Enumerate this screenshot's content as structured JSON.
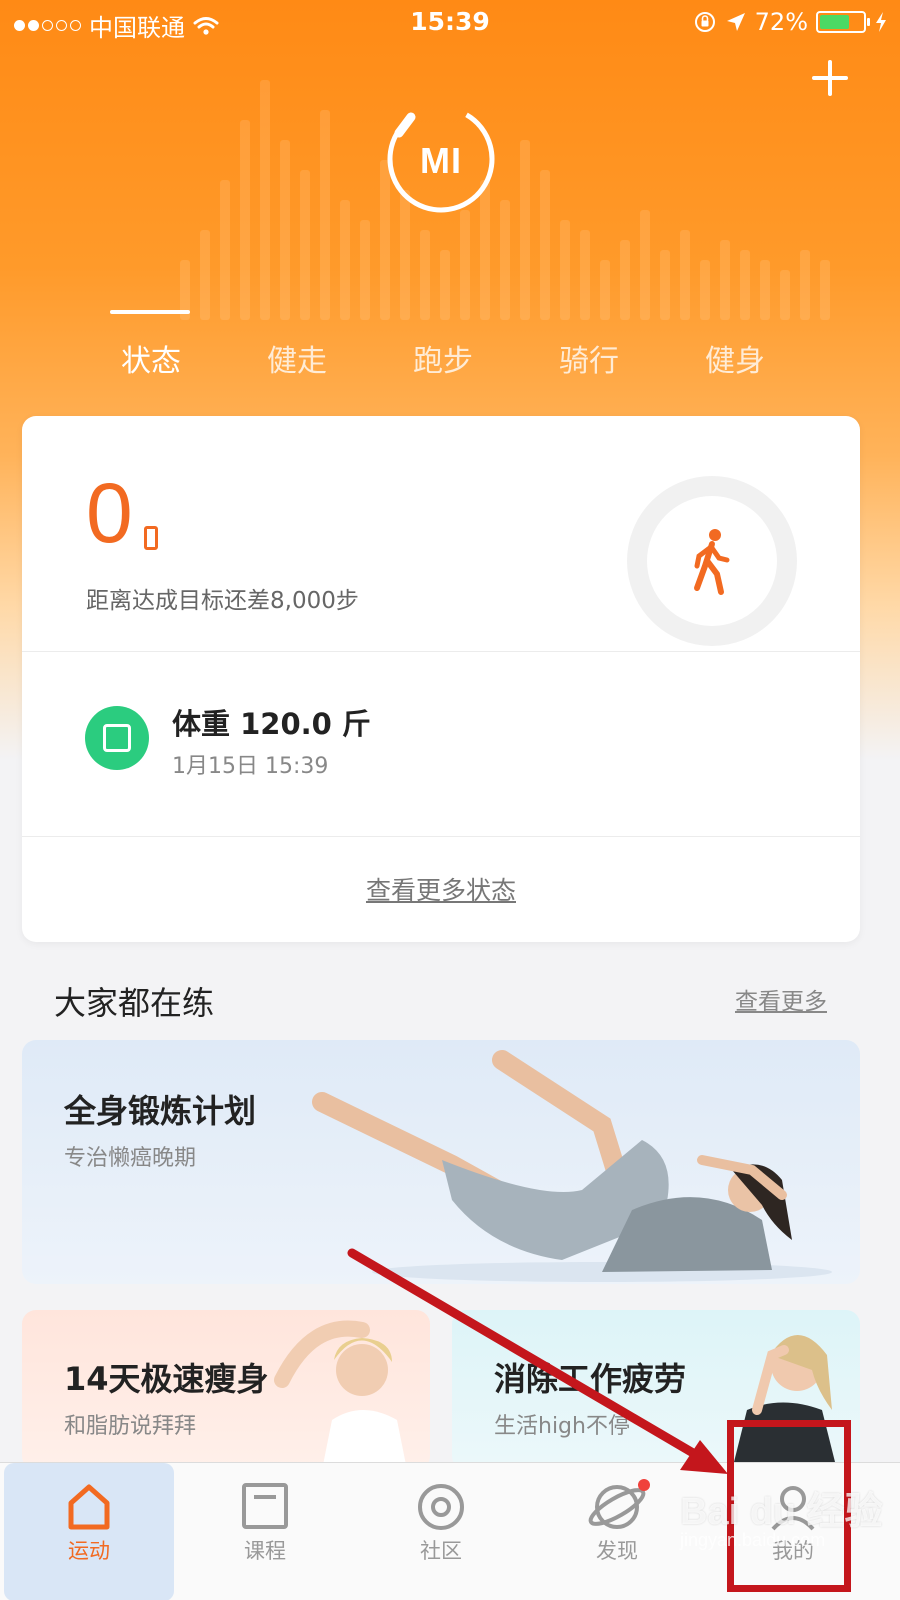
{
  "status_bar": {
    "carrier": "中国联通",
    "time": "15:39",
    "battery_percent": "72%",
    "signal_bars_filled": 2,
    "signal_bars_total": 5
  },
  "header": {
    "logo_text": "MI",
    "tabs": [
      {
        "label": "状态",
        "active": true
      },
      {
        "label": "健走",
        "active": false
      },
      {
        "label": "跑步",
        "active": false
      },
      {
        "label": "骑行",
        "active": false
      },
      {
        "label": "健身",
        "active": false
      }
    ]
  },
  "status_card": {
    "steps": "0",
    "goal_text": "距离达成目标还差8,000步",
    "weight_title": "体重 120.0 斤",
    "weight_time": "1月15日 15:39",
    "more_link": "查看更多状态"
  },
  "section": {
    "title": "大家都在练",
    "more_link": "查看更多"
  },
  "promos": [
    {
      "title": "全身锻炼计划",
      "subtitle": "专治懒癌晚期"
    },
    {
      "title": "14天极速瘦身",
      "subtitle": "和脂肪说拜拜"
    },
    {
      "title": "消除工作疲劳",
      "subtitle": "生活high不停"
    }
  ],
  "bottom_nav": [
    {
      "label": "运动",
      "icon": "home-icon",
      "active": true
    },
    {
      "label": "课程",
      "icon": "course-icon",
      "active": false
    },
    {
      "label": "社区",
      "icon": "community-icon",
      "active": false
    },
    {
      "label": "发现",
      "icon": "discover-icon",
      "active": false,
      "badge": true
    },
    {
      "label": "我的",
      "icon": "profile-icon",
      "active": false
    }
  ],
  "watermark": {
    "text": "Bai du 经验",
    "url_text": "jingyan.baidu.com"
  },
  "colors": {
    "brand_orange": "#f26a21",
    "header_orange": "#ff8a15",
    "weight_green": "#2bcc7f",
    "annotation_red": "#c4161c"
  }
}
